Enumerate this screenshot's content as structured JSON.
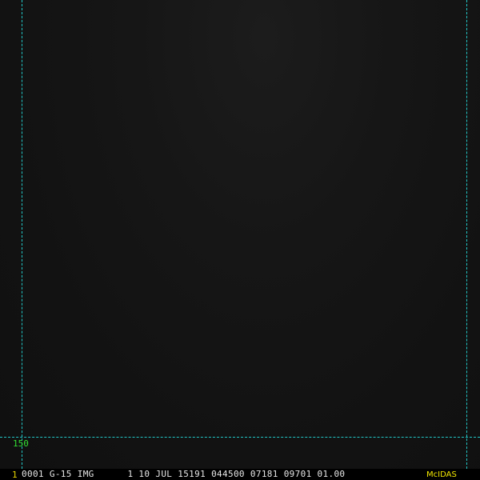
{
  "display": {
    "grid_label": "150",
    "frame_number": "1",
    "status_line": "0001 G-15 IMG      1 10 JUL 15191 044500 07181 09701 01.00",
    "brand": "McIDAS"
  },
  "colors": {
    "background": "#121212",
    "guide_lines": "#22c8c8",
    "grid_label": "#33dd33",
    "frame_number": "#e8d400",
    "status_text": "#e6e6e6",
    "brand": "#f2e600"
  }
}
